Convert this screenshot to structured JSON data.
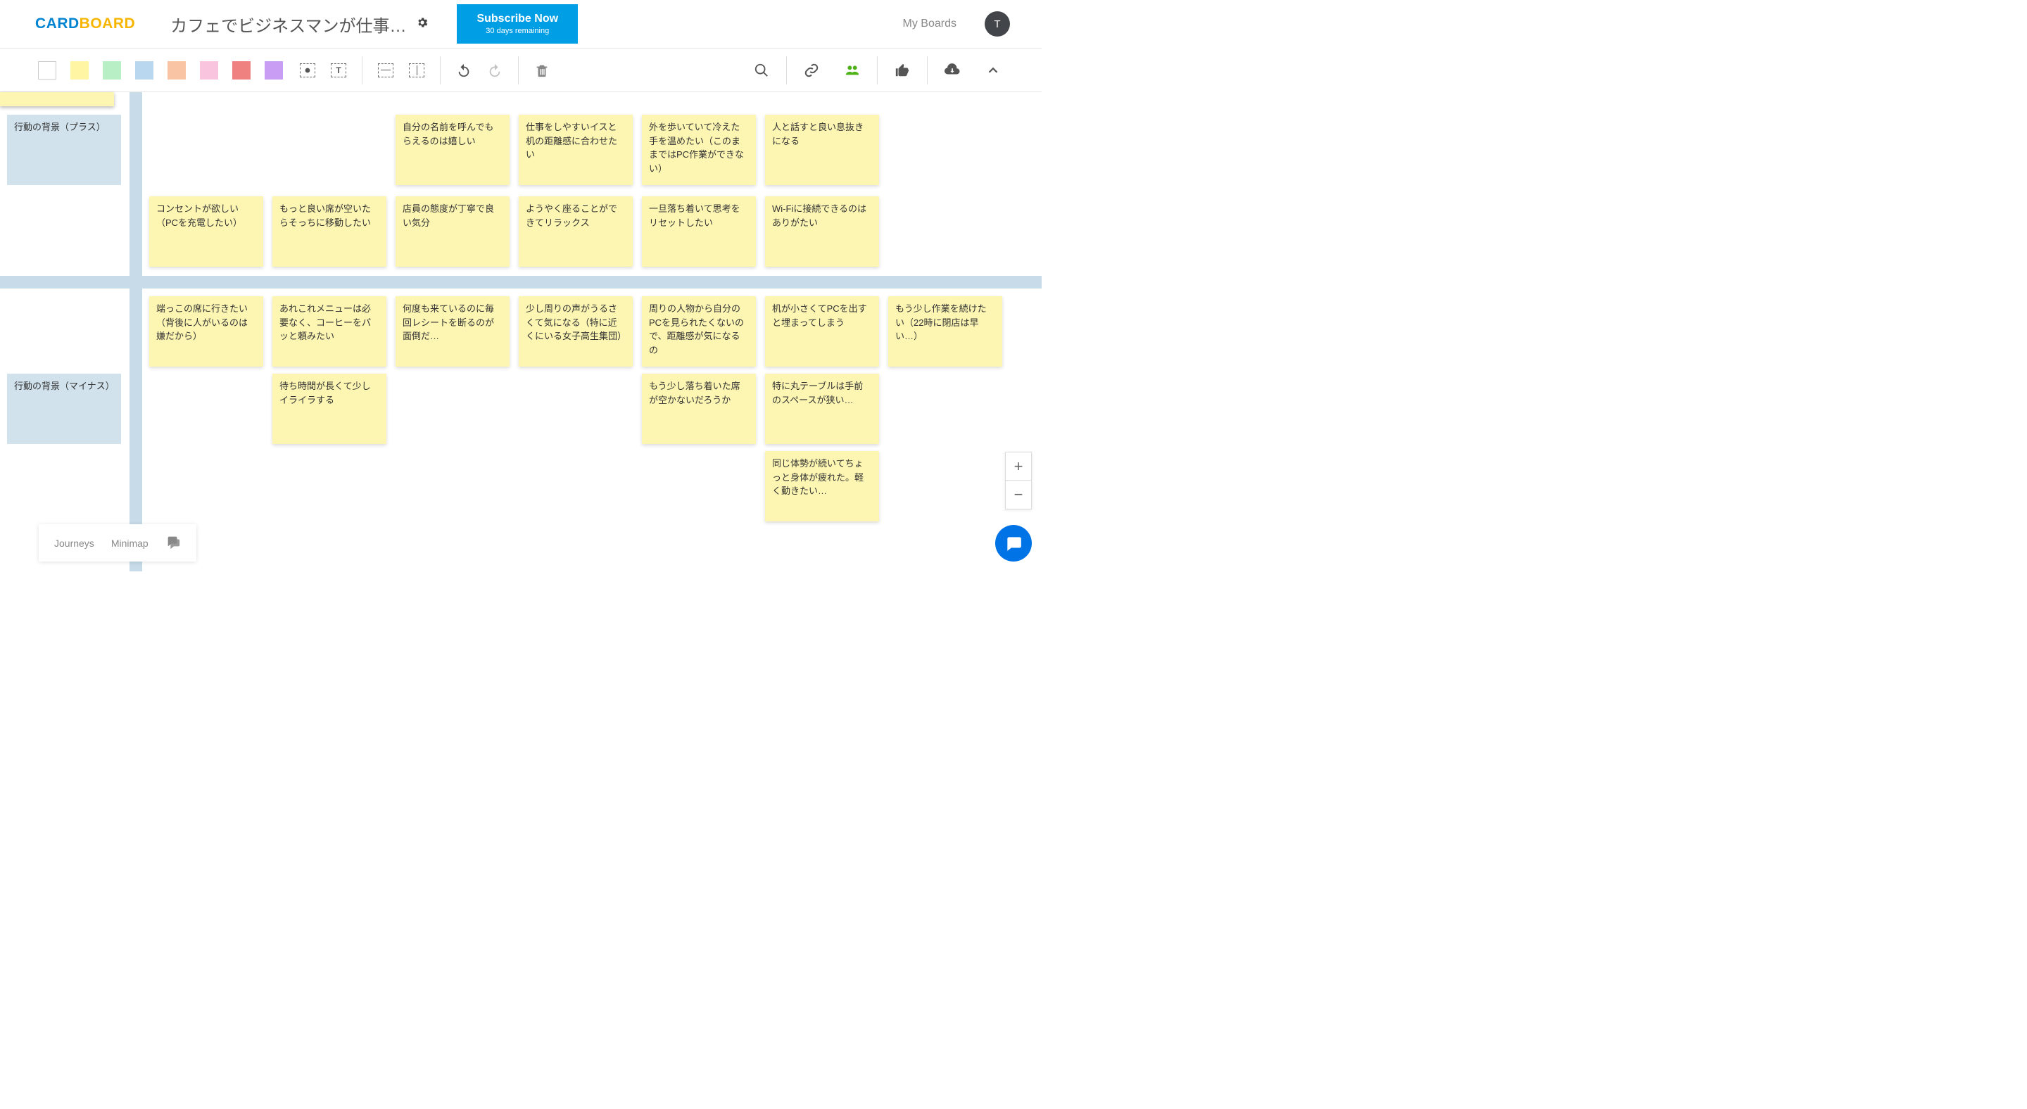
{
  "header": {
    "logo_part1": "CARD",
    "logo_part2": "BOARD",
    "title": "カフェでビジネスマンが仕事…",
    "subscribe_label": "Subscribe Now",
    "subscribe_sub": "30 days remaining",
    "my_boards": "My Boards",
    "avatar_initial": "T"
  },
  "row_labels": {
    "plus": "行動の背景（プラス）",
    "minus": "行動の背景（マイナス）"
  },
  "cards": {
    "top_partial": [
      "",
      ""
    ],
    "r1": [
      "自分の名前を呼んでもらえるのは嬉しい",
      "仕事をしやすいイスと机の距離感に合わせたい",
      "外を歩いていて冷えた手を温めたい（このままではPC作業ができない）",
      "人と話すと良い息抜きになる"
    ],
    "r2": [
      "コンセントが欲しい（PCを充電したい）",
      "もっと良い席が空いたらそっちに移動したい",
      "店員の態度が丁寧で良い気分",
      "ようやく座ることができてリラックス",
      "一旦落ち着いて思考をリセットしたい",
      "Wi-Fiに接続できるのはありがたい"
    ],
    "r3": [
      "端っこの席に行きたい（背後に人がいるのは嫌だから）",
      "あれこれメニューは必要なく、コーヒーをパッと頼みたい",
      "何度も来ているのに毎回レシートを断るのが面倒だ…",
      "少し周りの声がうるさくて気になる（特に近くにいる女子高生集団）",
      "周りの人物から自分のPCを見られたくないので、距離感が気になるの",
      "机が小さくてPCを出すと埋まってしまう",
      "もう少し作業を続けたい（22時に閉店は早い…）"
    ],
    "r4": [
      "待ち時間が長くて少しイライラする",
      "もう少し落ち着いた席が空かないだろうか",
      "特に丸テーブルは手前のスペースが狭い…"
    ],
    "r5": [
      "同じ体勢が続いてちょっと身体が疲れた。軽く動きたい…"
    ]
  },
  "footer": {
    "journeys": "Journeys",
    "minimap": "Minimap"
  },
  "zoom": {
    "in": "+",
    "out": "−"
  }
}
